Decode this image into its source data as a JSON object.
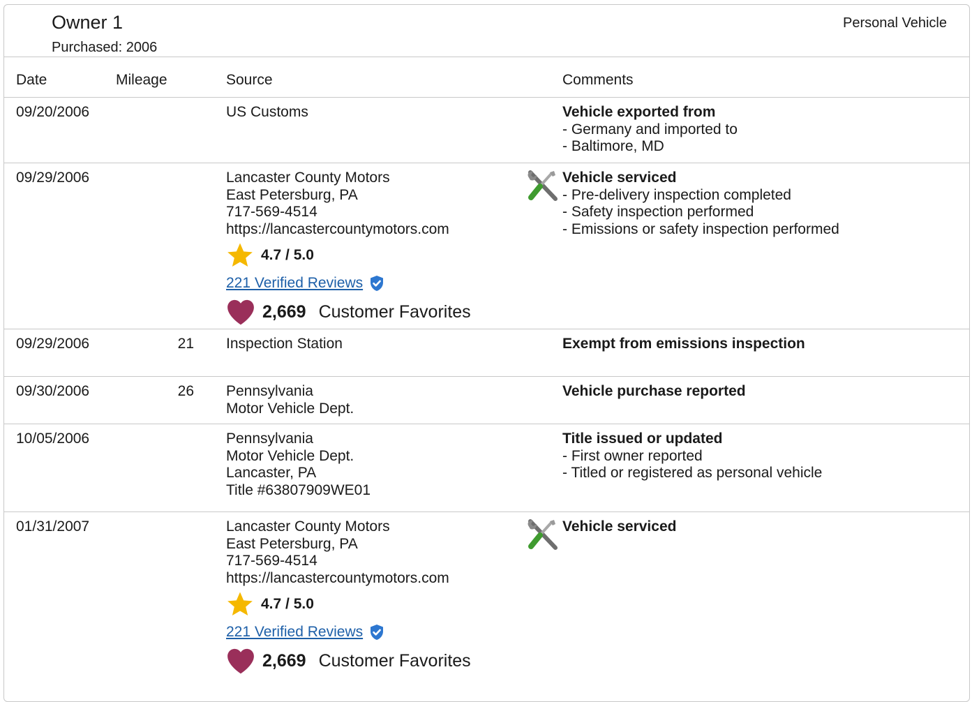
{
  "owner": {
    "title": "Owner 1",
    "purchased": "Purchased: 2006",
    "vehicle_type": "Personal Vehicle"
  },
  "table": {
    "headers": {
      "date": "Date",
      "mileage": "Mileage",
      "source": "Source",
      "comments": "Comments"
    },
    "rows": [
      {
        "date": "09/20/2006",
        "mileage": "",
        "source": [
          "US Customs"
        ],
        "comment_title": "Vehicle exported from",
        "comment_lines": [
          "- Germany and imported to",
          "- Baltimore, MD"
        ]
      },
      {
        "date": "09/29/2006",
        "mileage": "",
        "source": [
          "Lancaster County Motors",
          "East Petersburg, PA",
          "717-569-4514",
          "https://lancastercountymotors.com"
        ],
        "rating": "4.7 / 5.0",
        "reviews": "221 Verified Reviews",
        "favorites_count": "2,669",
        "favorites_label": "Customer Favorites",
        "service_icon": "wrench-screwdriver-icon",
        "comment_title": "Vehicle serviced",
        "comment_lines": [
          "- Pre-delivery inspection completed",
          "- Safety inspection performed",
          "- Emissions or safety inspection performed"
        ]
      },
      {
        "date": "09/29/2006",
        "mileage": "21",
        "source": [
          "Inspection Station"
        ],
        "comment_title": "Exempt from emissions inspection",
        "comment_lines": []
      },
      {
        "date": "09/30/2006",
        "mileage": "26",
        "source": [
          "Pennsylvania",
          "Motor Vehicle Dept."
        ],
        "comment_title": "Vehicle purchase reported",
        "comment_lines": []
      },
      {
        "date": "10/05/2006",
        "mileage": "",
        "source": [
          "Pennsylvania",
          "Motor Vehicle Dept.",
          "Lancaster, PA",
          "Title #63807909WE01"
        ],
        "comment_title": "Title issued or updated",
        "comment_lines": [
          "- First owner reported",
          "- Titled or registered as personal vehicle"
        ]
      },
      {
        "date": "01/31/2007",
        "mileage": "",
        "source": [
          "Lancaster County Motors",
          "East Petersburg, PA",
          "717-569-4514",
          "https://lancastercountymotors.com"
        ],
        "rating": "4.7 / 5.0",
        "reviews": "221 Verified Reviews",
        "favorites_count": "2,669",
        "favorites_label": "Customer Favorites",
        "service_icon": "wrench-screwdriver-icon",
        "comment_title": "Vehicle serviced",
        "comment_lines": []
      }
    ]
  },
  "colors": {
    "star": "#f5b800",
    "heart": "#9a2f5a",
    "verified": "#2d77d0",
    "link": "#1d5fa8",
    "border": "#c8c8c8"
  }
}
